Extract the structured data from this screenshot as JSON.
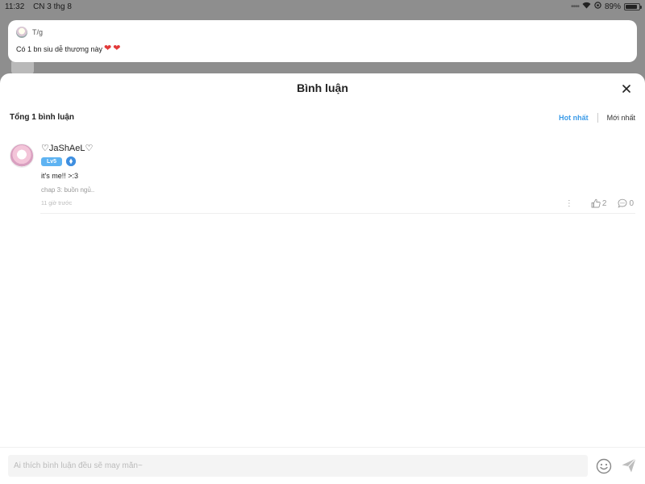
{
  "status_bar": {
    "time": "11:32",
    "date": "CN 3 thg 8",
    "battery": "89%",
    "battery_level": 0.89
  },
  "notification": {
    "sender": "T/g",
    "message": "Có 1 bn siu dễ thương này",
    "emoji_count": 2
  },
  "sheet": {
    "title": "Bình luận",
    "total_label": "Tổng 1 bình luận",
    "sort_hot": "Hot nhất",
    "sort_new": "Mới nhất"
  },
  "comments": [
    {
      "username": "♡JaShAeL♡",
      "level": "Lv5",
      "text": "it's me!! >:3",
      "chapter": "chap 3: buồn ngủ..",
      "time": "11 giờ trước",
      "likes": "2",
      "replies": "0"
    }
  ],
  "input": {
    "placeholder": "Ai thích bình luận đều sẽ may mắn~"
  },
  "colors": {
    "accent": "#3b9be8",
    "level_badge": "#5eb3f2",
    "heart": "#e23a3a"
  }
}
